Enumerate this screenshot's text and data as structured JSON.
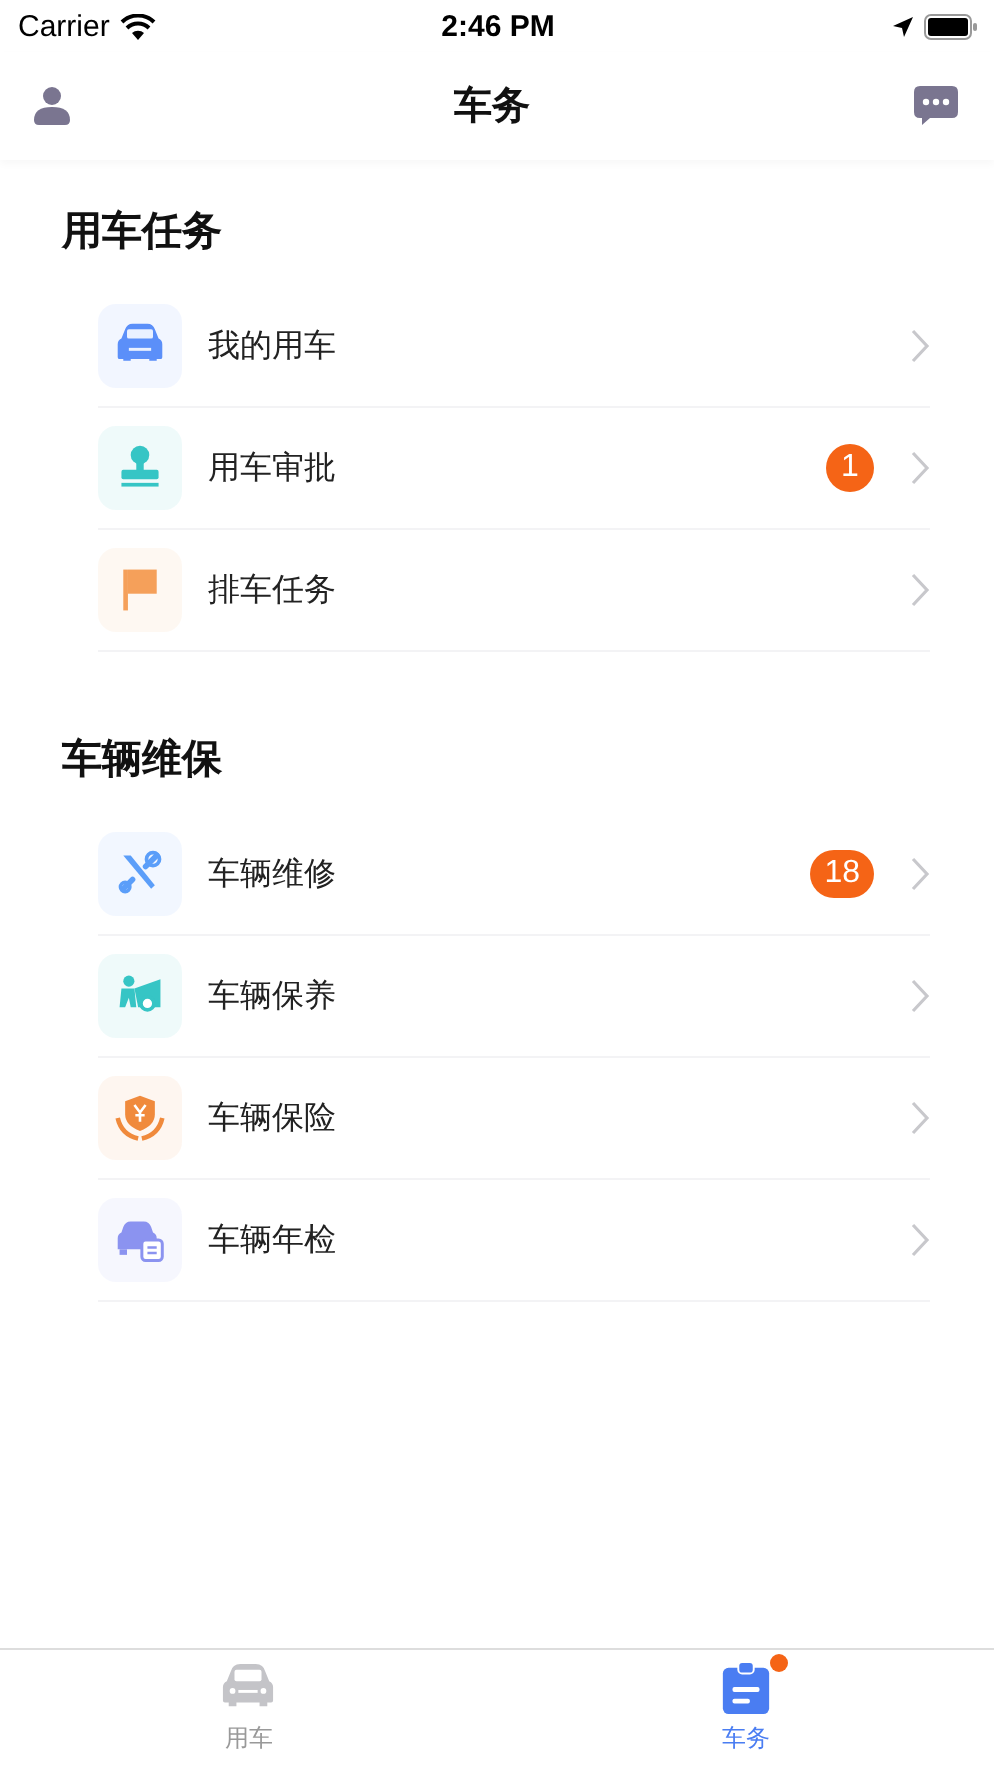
{
  "status_bar": {
    "carrier": "Carrier",
    "time": "2:46 PM"
  },
  "nav": {
    "title": "车务"
  },
  "sections": [
    {
      "title": "用车任务",
      "items": [
        {
          "label": "我的用车",
          "color": "#5b8ff9"
        },
        {
          "label": "用车审批",
          "color": "#36c5c5",
          "badge": "1"
        },
        {
          "label": "排车任务",
          "color": "#f5a05a"
        }
      ]
    },
    {
      "title": "车辆维保",
      "items": [
        {
          "label": "车辆维修",
          "color": "#5b9ef9",
          "badge": "18"
        },
        {
          "label": "车辆保养",
          "color": "#36c5c5"
        },
        {
          "label": "车辆保险",
          "color": "#f08a3c"
        },
        {
          "label": "车辆年检",
          "color": "#8b93f0"
        }
      ]
    }
  ],
  "tabs": [
    {
      "label": "用车",
      "selected": false,
      "dot": false
    },
    {
      "label": "车务",
      "selected": true,
      "dot": true
    }
  ]
}
